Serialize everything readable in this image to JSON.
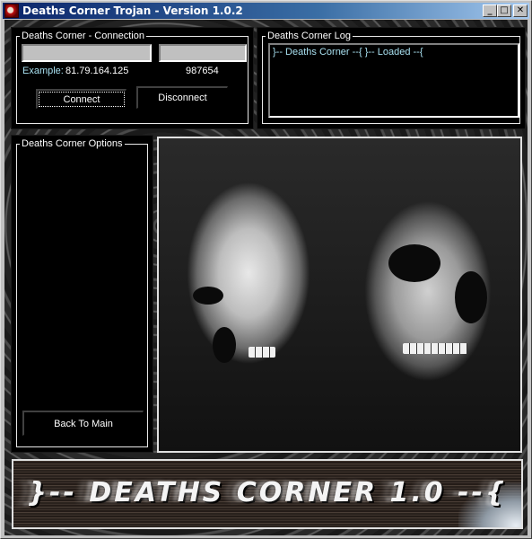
{
  "window": {
    "title": "Deaths Corner Trojan - Version 1.0.2",
    "icon": "skull-app-icon",
    "controls": {
      "minimize": "_",
      "maximize": "□",
      "close": "✕"
    }
  },
  "connection": {
    "label": "Deaths Corner - Connection",
    "ip_value": "",
    "port_value": "",
    "example_label": "Example:",
    "example_ip": "81.79.164.125",
    "example_port": "987654",
    "connect_label": "Connect",
    "disconnect_label": "Disconnect"
  },
  "log": {
    "label": "Deaths Corner Log",
    "lines": [
      "}-- Deaths Corner --{ }-- Loaded --{"
    ]
  },
  "options": {
    "label": "Deaths Corner Options",
    "back_label": "Back To Main"
  },
  "image": {
    "description": "two-skulls-photo"
  },
  "banner": {
    "text": "}-- DEATHS CORNER 1.0 --{"
  }
}
